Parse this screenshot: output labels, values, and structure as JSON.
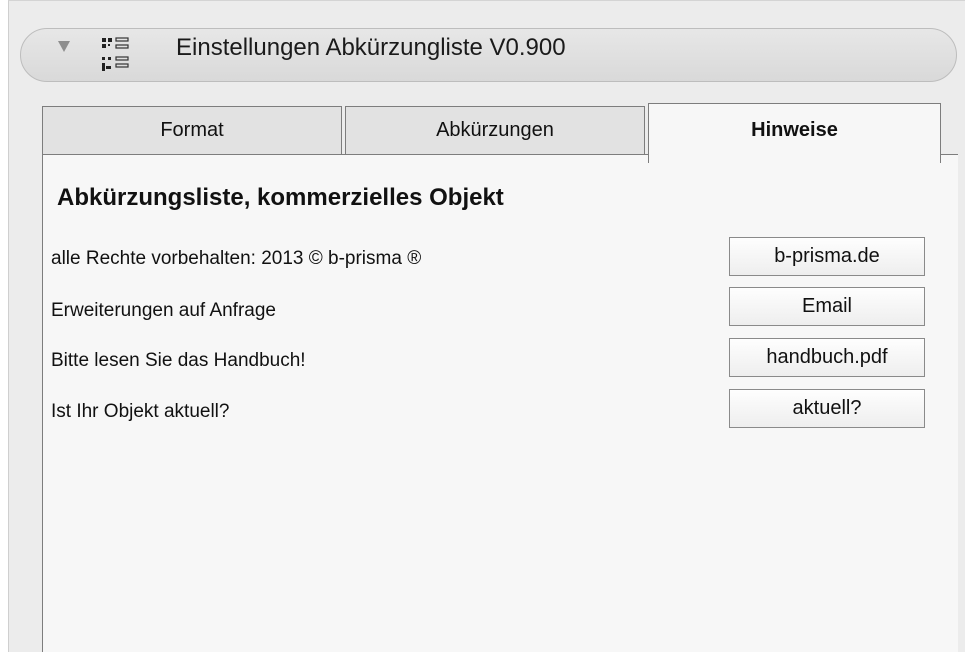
{
  "header": {
    "title": "Einstellungen Abkürzungliste V0.900",
    "icon": "list-settings-icon"
  },
  "tabs": [
    {
      "label": "Format",
      "active": false
    },
    {
      "label": "Abkürzungen",
      "active": false
    },
    {
      "label": "Hinweise",
      "active": true
    }
  ],
  "panel": {
    "heading": "Abkürzungsliste, kommerzielles Objekt",
    "rows": [
      {
        "text": "alle Rechte vorbehalten:  2013 © b-prisma ®",
        "button": "b-prisma.de"
      },
      {
        "text": "Erweiterungen auf Anfrage",
        "button": "Email"
      },
      {
        "text": "Bitte lesen Sie das Handbuch!",
        "button": "handbuch.pdf"
      },
      {
        "text": "Ist Ihr Objekt aktuell?",
        "button": "aktuell?"
      }
    ]
  },
  "colors": {
    "background": "#ececec",
    "panel": "#f7f7f7",
    "border": "#7d7d7d"
  }
}
